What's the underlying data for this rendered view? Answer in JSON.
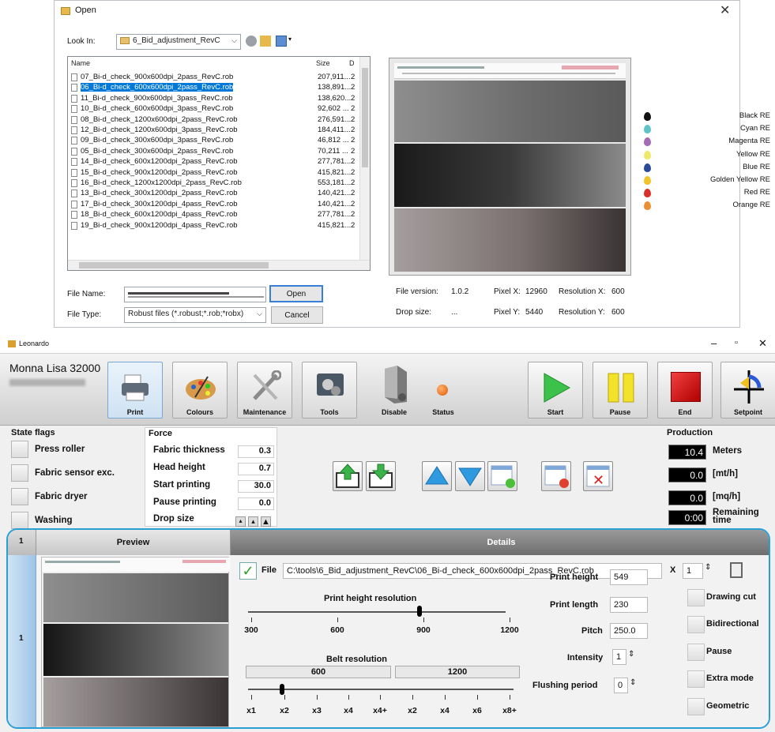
{
  "dialog": {
    "title": "Open",
    "look_in_label": "Look In:",
    "look_in_value": "6_Bid_adjustment_RevC",
    "columns": {
      "name": "Name",
      "size": "Size",
      "date": "D"
    },
    "files": [
      {
        "name": "07_Bi-d_check_900x600dpi_2pass_RevC.rob",
        "size": "207,911...",
        "date": "2"
      },
      {
        "name": "06_Bi-d_check_600x600dpi_2pass_RevC.rob",
        "size": "138,891...",
        "date": "2",
        "selected": true
      },
      {
        "name": "11_Bi-d_check_900x600dpi_3pass_RevC.rob",
        "size": "138,620...",
        "date": "2"
      },
      {
        "name": "10_Bi-d_check_600x600dpi_3pass_RevC.rob",
        "size": "92,602 ...",
        "date": "2"
      },
      {
        "name": "08_Bi-d_check_1200x600dpi_2pass_RevC.rob",
        "size": "276,591...",
        "date": "2"
      },
      {
        "name": "12_Bi-d_check_1200x600dpi_3pass_RevC.rob",
        "size": "184,411...",
        "date": "2"
      },
      {
        "name": "09_Bi-d_check_300x600dpi_3pass_RevC.rob",
        "size": "46,812 ...",
        "date": "2"
      },
      {
        "name": "05_Bi-d_check_300x600dpi_2pass_RevC.rob",
        "size": "70,211 ...",
        "date": "2"
      },
      {
        "name": "14_Bi-d_check_600x1200dpi_2pass_RevC.rob",
        "size": "277,781...",
        "date": "2"
      },
      {
        "name": "15_Bi-d_check_900x1200dpi_2pass_RevC.rob",
        "size": "415,821...",
        "date": "2"
      },
      {
        "name": "16_Bi-d_check_1200x1200dpi_2pass_RevC.rob",
        "size": "553,181...",
        "date": "2"
      },
      {
        "name": "13_Bi-d_check_300x1200dpi_2pass_RevC.rob",
        "size": "140,421...",
        "date": "2"
      },
      {
        "name": "17_Bi-d_check_300x1200dpi_4pass_RevC.rob",
        "size": "140,421...",
        "date": "2"
      },
      {
        "name": "18_Bi-d_check_600x1200dpi_4pass_RevC.rob",
        "size": "277,781...",
        "date": "2"
      },
      {
        "name": "19_Bi-d_check_900x1200dpi_4pass_RevC.rob",
        "size": "415,821...",
        "date": "2"
      }
    ],
    "file_name_label": "File Name:",
    "file_type_label": "File Type:",
    "file_type_value": "Robust files (*.robust;*.rob;*robx)",
    "open_button": "Open",
    "cancel_button": "Cancel",
    "info": {
      "file_version_label": "File version:",
      "file_version": "1.0.2",
      "drop_size_label": "Drop size:",
      "drop_size": "...",
      "pixel_x_label": "Pixel X:",
      "pixel_x": "12960",
      "pixel_y_label": "Pixel Y:",
      "pixel_y": "5440",
      "res_x_label": "Resolution X:",
      "res_x": "600",
      "res_y_label": "Resolution Y:",
      "res_y": "600"
    },
    "inks": [
      {
        "name": "Black RE",
        "color": "#111111"
      },
      {
        "name": "Cyan RE",
        "color": "#5fc4c8"
      },
      {
        "name": "Magenta RE",
        "color": "#a66bb5"
      },
      {
        "name": "Yellow RE",
        "color": "#f0e86a"
      },
      {
        "name": "Blue RE",
        "color": "#2b4a9a"
      },
      {
        "name": "Golden Yellow RE",
        "color": "#f0c42a"
      },
      {
        "name": "Red RE",
        "color": "#d8302a"
      },
      {
        "name": "Orange RE",
        "color": "#ec8f33"
      }
    ]
  },
  "app": {
    "title": "Leonardo",
    "machine": "Monna Lisa 32000",
    "toolbar": {
      "print": "Print",
      "colours": "Colours",
      "maintenance": "Maintenance",
      "tools": "Tools",
      "disable": "Disable",
      "status": "Status",
      "start": "Start",
      "pause": "Pause",
      "end": "End",
      "setpoint": "Setpoint"
    },
    "state_flags": {
      "title": "State flags",
      "items": [
        "Press roller",
        "Fabric sensor exc.",
        "Fabric dryer",
        "Washing"
      ]
    },
    "force": {
      "title": "Force",
      "rows": [
        {
          "label": "Fabric thickness",
          "value": "0.3"
        },
        {
          "label": "Head height",
          "value": "0.7"
        },
        {
          "label": "Start printing",
          "value": "30.0"
        },
        {
          "label": "Pause printing",
          "value": "0.0"
        },
        {
          "label": "Drop size",
          "value": ""
        }
      ]
    },
    "production": {
      "title": "Production",
      "rows": [
        {
          "value": "10.4",
          "unit": "Meters"
        },
        {
          "value": "0.0",
          "unit": "[mt/h]"
        },
        {
          "value": "0.0",
          "unit": "[mq/h]"
        },
        {
          "value": "0:00",
          "unit": "Remaining time"
        }
      ]
    },
    "grid": {
      "col_index": "1",
      "col_preview": "Preview",
      "col_details": "Details",
      "row_index": "1"
    },
    "details": {
      "file_label": "File",
      "file_path": "C:\\tools\\6_Bid_adjustment_RevC\\06_Bi-d_check_600x600dpi_2pass_RevC.rob",
      "x_label": "X",
      "copies": "1",
      "print_height_res_title": "Print height resolution",
      "print_height_res_ticks": [
        "300",
        "600",
        "900",
        "1200"
      ],
      "print_height_res_value": "900",
      "belt_res_title": "Belt resolution",
      "belt_groups": [
        "600",
        "1200"
      ],
      "belt_ticks": [
        "x1",
        "x2",
        "x3",
        "x4",
        "x4+",
        "x2",
        "x4",
        "x6",
        "x8+"
      ],
      "belt_value": "x2",
      "print_height_label": "Print height",
      "print_height": "549",
      "print_length_label": "Print length",
      "print_length": "230",
      "pitch_label": "Pitch",
      "pitch": "250.0",
      "intensity_label": "Intensity",
      "intensity": "1",
      "flushing_label": "Flushing period",
      "flushing": "0",
      "options": [
        "Drawing cut",
        "Bidirectional",
        "Pause",
        "Extra mode",
        "Geometric"
      ]
    }
  }
}
